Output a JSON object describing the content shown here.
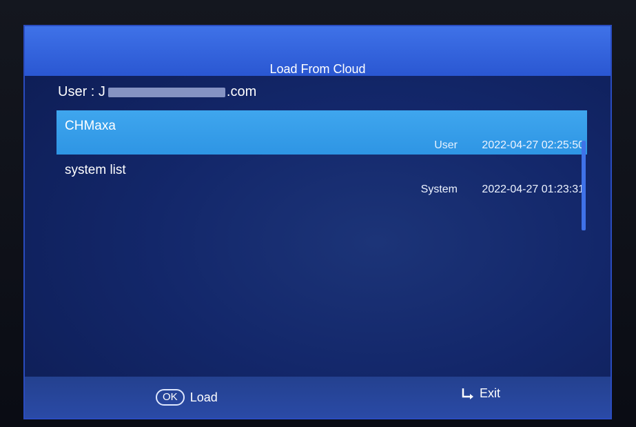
{
  "dialog": {
    "title": "Load From Cloud",
    "user_label": "User :",
    "user_prefix": "J",
    "user_suffix": ".com"
  },
  "list": {
    "items": [
      {
        "name": "CHMaxa",
        "type": "User",
        "date": "2022-04-27 02:25:50",
        "selected": true
      },
      {
        "name": "system list",
        "type": "System",
        "date": "2022-04-27 01:23:31",
        "selected": false
      }
    ]
  },
  "footer": {
    "ok_badge": "OK",
    "ok_label": "Load",
    "exit_label": "Exit"
  },
  "colors": {
    "title_bar": "#2f60dc",
    "selected_row": "#3aa0ea",
    "background": "#13276a"
  },
  "icons": {
    "ok": "ok-button-icon",
    "exit": "return-arrow-icon"
  }
}
